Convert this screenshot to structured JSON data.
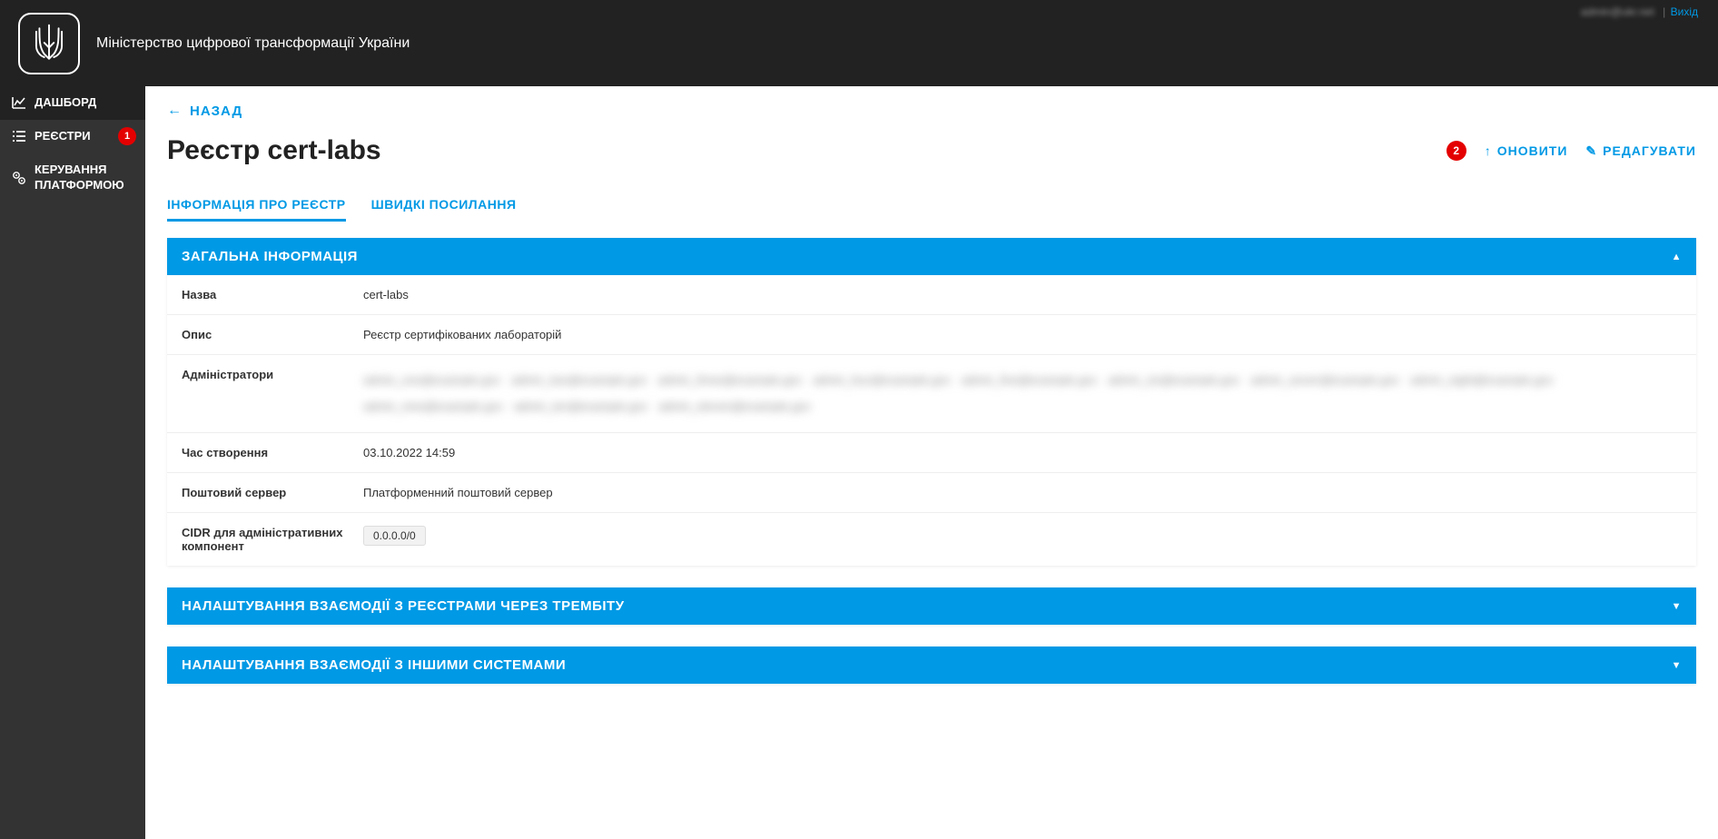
{
  "header": {
    "title": "Міністерство цифрової трансформації України",
    "user_blurred": "admin@ukr.net",
    "logout": "Вихід"
  },
  "sidebar": {
    "items": [
      {
        "label": "ДАШБОРД",
        "icon": "chart"
      },
      {
        "label": "РЕЄСТРИ",
        "icon": "list",
        "badge": "1",
        "dark": true
      },
      {
        "label": "КЕРУВАННЯ ПЛАТФОРМОЮ",
        "icon": "gear"
      }
    ]
  },
  "back": {
    "label": "НАЗАД"
  },
  "page": {
    "title": "Реєстр cert-labs",
    "marker2": "2",
    "refresh": "ОНОВИТИ",
    "edit": "РЕДАГУВАТИ"
  },
  "tabs": [
    {
      "label": "ІНФОРМАЦІЯ ПРО РЕЄСТР",
      "active": true
    },
    {
      "label": "ШВИДКІ ПОСИЛАННЯ",
      "active": false
    }
  ],
  "panels": {
    "general": {
      "title": "ЗАГАЛЬНА ІНФОРМАЦІЯ",
      "rows": {
        "name_label": "Назва",
        "name_value": "cert-labs",
        "desc_label": "Опис",
        "desc_value": "Реєстр сертифікованих лабораторій",
        "admins_label": "Адміністратори",
        "admins_blurred": "admin_one@example.gov admin_two@example.gov admin_three@example.gov admin_four@example.gov admin_five@example.gov admin_six@example.gov admin_seven@example.gov admin_eight@example.gov admin_nine@example.gov admin_ten@example.gov admin_eleven@example.gov",
        "created_label": "Час створення",
        "created_value": "03.10.2022 14:59",
        "mail_label": "Поштовий сервер",
        "mail_value": "Платформенний поштовий сервер",
        "cidr_label": "CIDR для адміністративних компонент",
        "cidr_value": "0.0.0.0/0"
      }
    },
    "trembita": {
      "title": "НАЛАШТУВАННЯ ВЗАЄМОДІЇ З РЕЄСТРАМИ ЧЕРЕЗ ТРЕМБІТУ"
    },
    "other": {
      "title": "НАЛАШТУВАННЯ ВЗАЄМОДІЇ З ІНШИМИ СИСТЕМАМИ"
    }
  }
}
